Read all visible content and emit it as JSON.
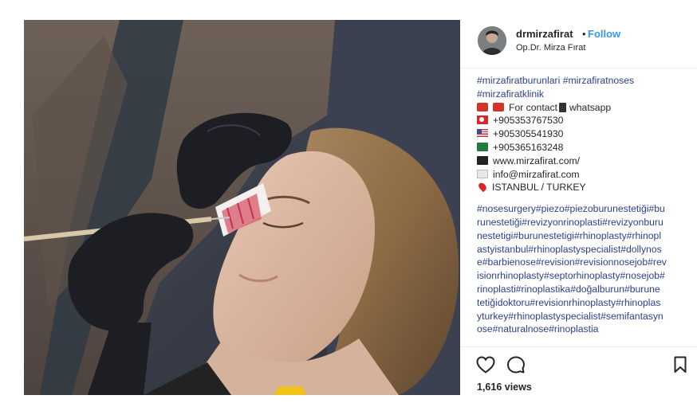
{
  "post": {
    "image_overlay_text": "",
    "account": {
      "username": "drmirzafirat",
      "separator": "•",
      "follow_label": "Follow",
      "subtitle": "Op.Dr. Mirza Fırat"
    },
    "caption": {
      "hashtags_top": "#mirzafiratburunlari #mirzafiratnoses",
      "hashtags_top2": "#mirzafiratklinik",
      "contact_line": "For contact",
      "contact_whatsapp": "whatsapp",
      "phone_tr": "+905353767530",
      "phone_us": "+905305541930",
      "phone_sa": "+905365163248",
      "website": "www.mirzafirat.com/",
      "email": "info@mirzafirat.com",
      "location": "ISTANBUL / TURKEY",
      "hashtag_block": [
        "#nosesurgery#piezo#piezoburunestetiği#bu",
        "runestetiği#revizyonrinoplasti#revizyonburu",
        "nestetigi#burunestetigi#rhinoplasty#rhinopl",
        "astyistanbul#rhinoplastyspecialist#dollynos",
        "e#barbienose#revision#revisionnosejob#rev",
        "isionrhinoplasty#septorhinoplasty#nosejob#",
        "rinoplasti#rinoplastika#doğalburun#burune",
        "tetiğidoktoru#revisionrhinoplasty#rhinoplas",
        "yturkey#rhinoplastyspecialist#semifantasyn",
        "ose#naturalnose#rinoplastia"
      ]
    },
    "icons": {
      "like": "heart-icon",
      "comment": "comment-icon",
      "save": "bookmark-icon"
    },
    "views": "1,616 views"
  },
  "colors": {
    "link_blue": "#3897f0",
    "hashtag_blue": "#2b3f8f",
    "text": "#262626"
  }
}
